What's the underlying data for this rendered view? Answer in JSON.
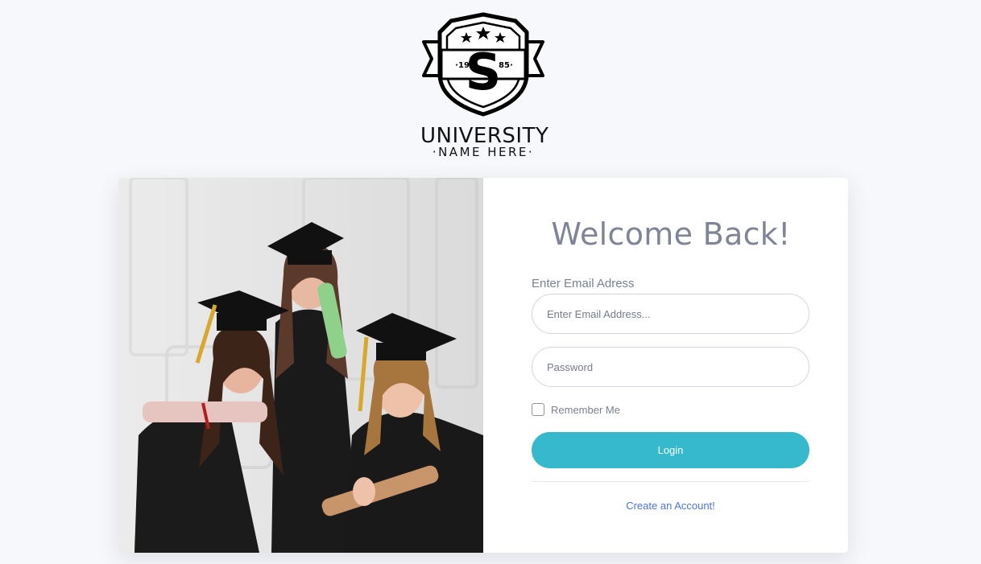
{
  "logo": {
    "year_left": "19",
    "letter": "S",
    "year_right": "85",
    "line1": "UNIVERSITY",
    "line2": "·NAME HERE·"
  },
  "photo": {
    "description_icon": "graduates-photo"
  },
  "form": {
    "title": "Welcome Back!",
    "email_label": "Enter Email Adress",
    "email_placeholder": "Enter Email Address...",
    "password_placeholder": "Password",
    "remember_label": "Remember Me",
    "login_label": "Login",
    "create_account_label": "Create an Account!"
  },
  "colors": {
    "background": "#f7f8fb",
    "primary_button": "#36b9cc",
    "link": "#4e73df",
    "title": "#7f8496"
  }
}
